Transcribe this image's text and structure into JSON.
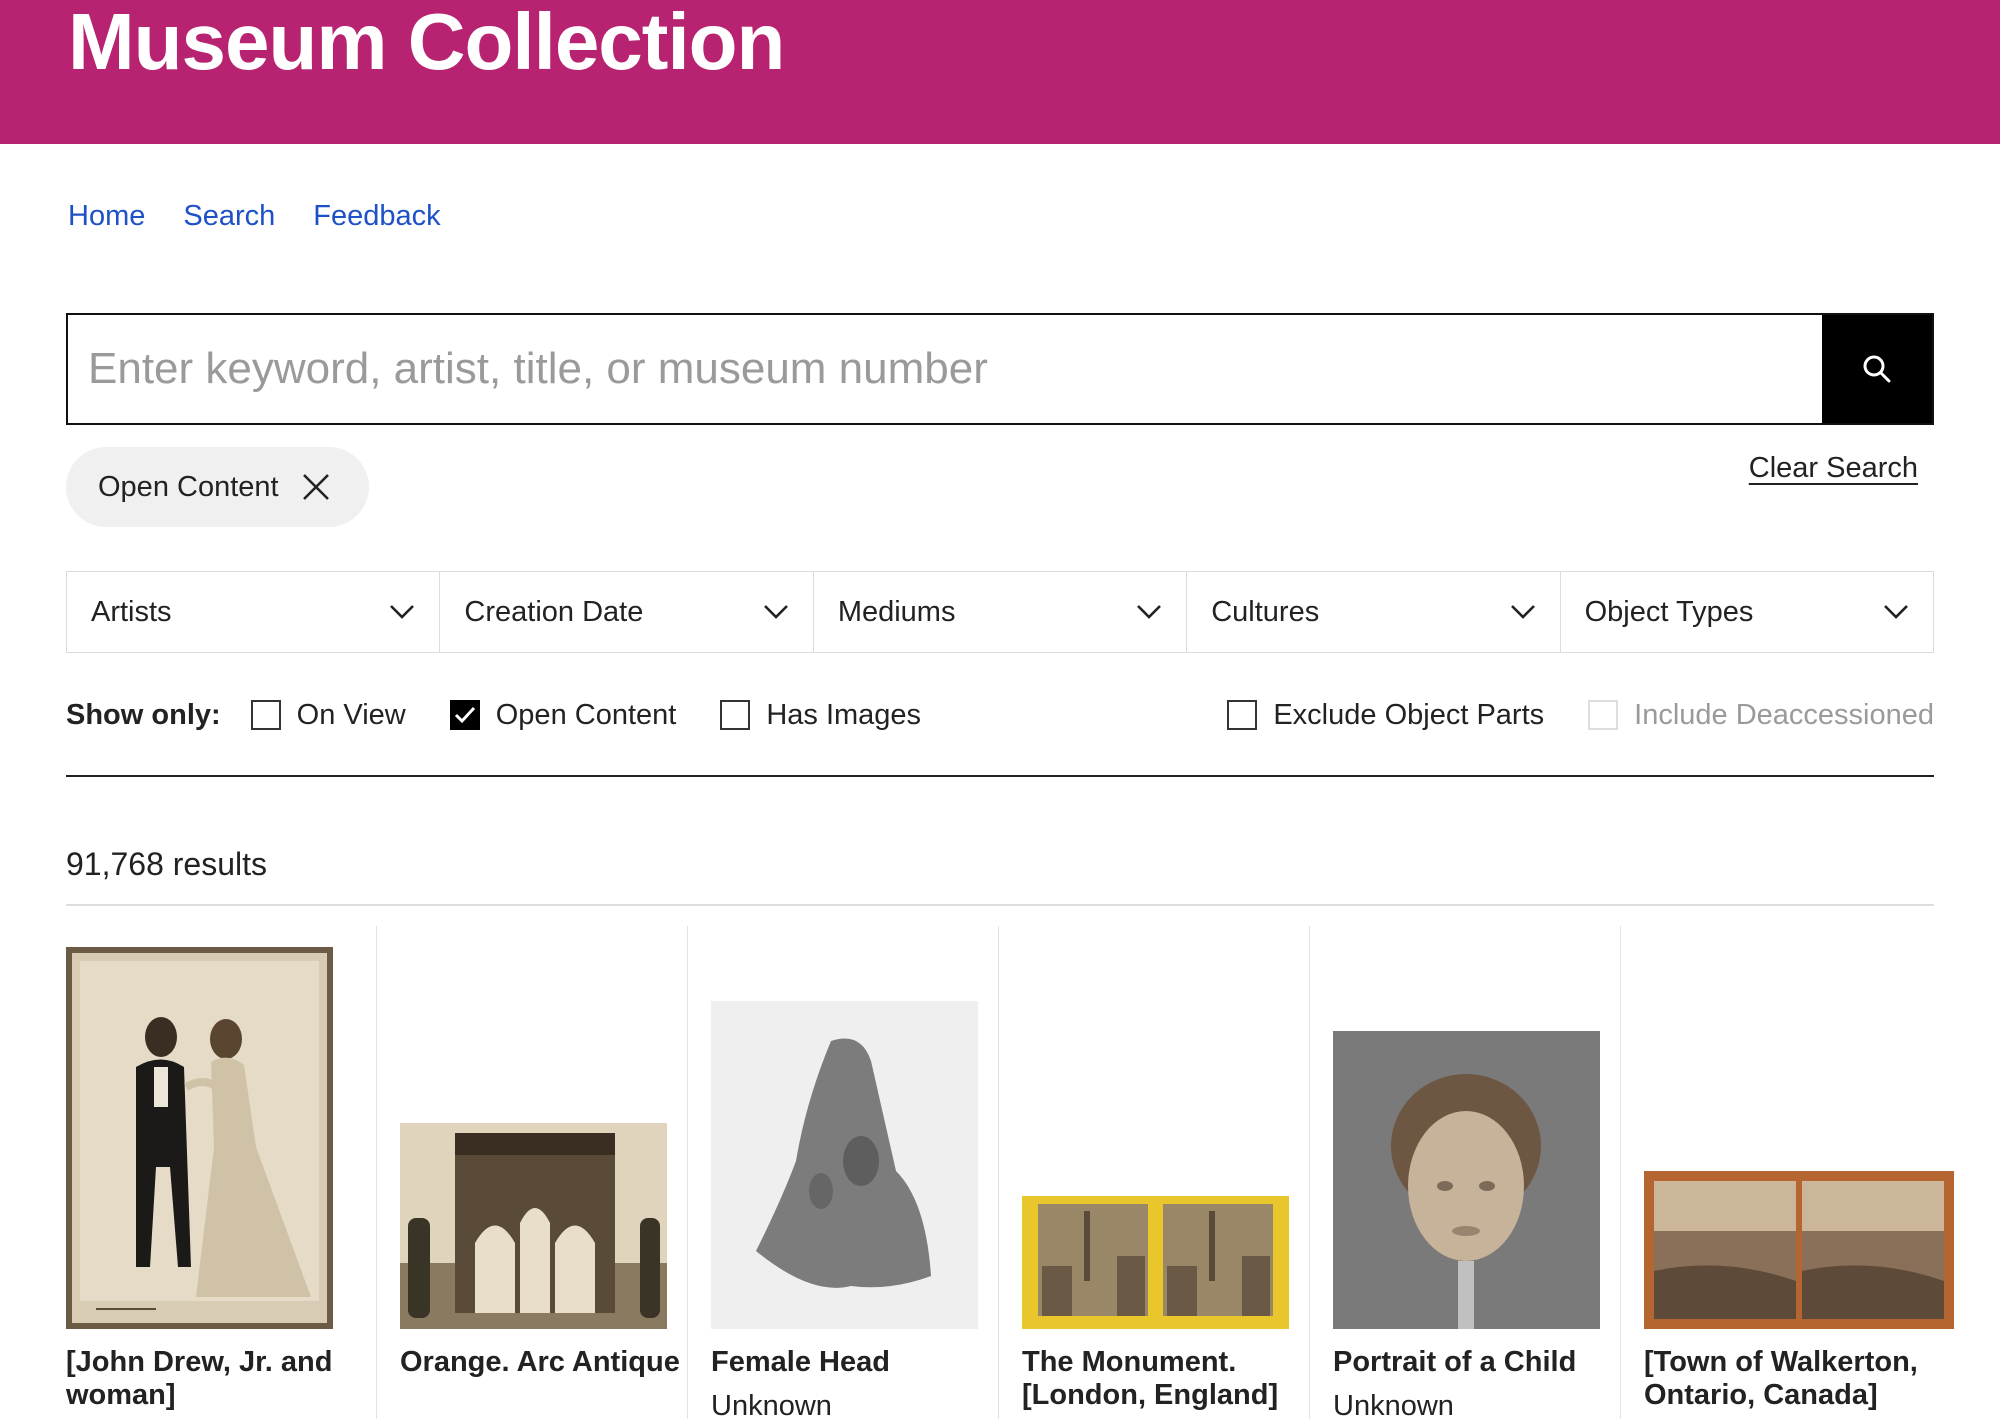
{
  "header": {
    "title": "Museum Collection"
  },
  "nav": {
    "home": "Home",
    "search": "Search",
    "feedback": "Feedback"
  },
  "search": {
    "placeholder": "Enter keyword, artist, title, or museum number",
    "value": ""
  },
  "active_filter": {
    "label": "Open Content"
  },
  "clear_search": "Clear Search",
  "filters": [
    "Artists",
    "Creation Date",
    "Mediums",
    "Cultures",
    "Object Types"
  ],
  "show_only": {
    "label": "Show only:",
    "options": [
      {
        "label": "On View",
        "checked": false
      },
      {
        "label": "Open Content",
        "checked": true
      },
      {
        "label": "Has Images",
        "checked": false
      },
      {
        "label": "Exclude Object Parts",
        "checked": false
      },
      {
        "label": "Include Deaccessioned",
        "checked": false,
        "disabled": true
      }
    ]
  },
  "results": {
    "count": "91,768 results"
  },
  "cards": [
    {
      "title": "[John Drew, Jr. and woman]",
      "artist": ""
    },
    {
      "title": "Orange. Arc Antique",
      "artist": ""
    },
    {
      "title": "Female Head",
      "artist": "Unknown"
    },
    {
      "title": "The Monument. [London, England]",
      "artist": ""
    },
    {
      "title": "Portrait of a Child",
      "artist": "Unknown"
    },
    {
      "title": "[Town of Walkerton, Ontario, Canada]",
      "artist": ""
    }
  ],
  "colors": {
    "brand": "#b82371",
    "link": "#1e50c8"
  }
}
